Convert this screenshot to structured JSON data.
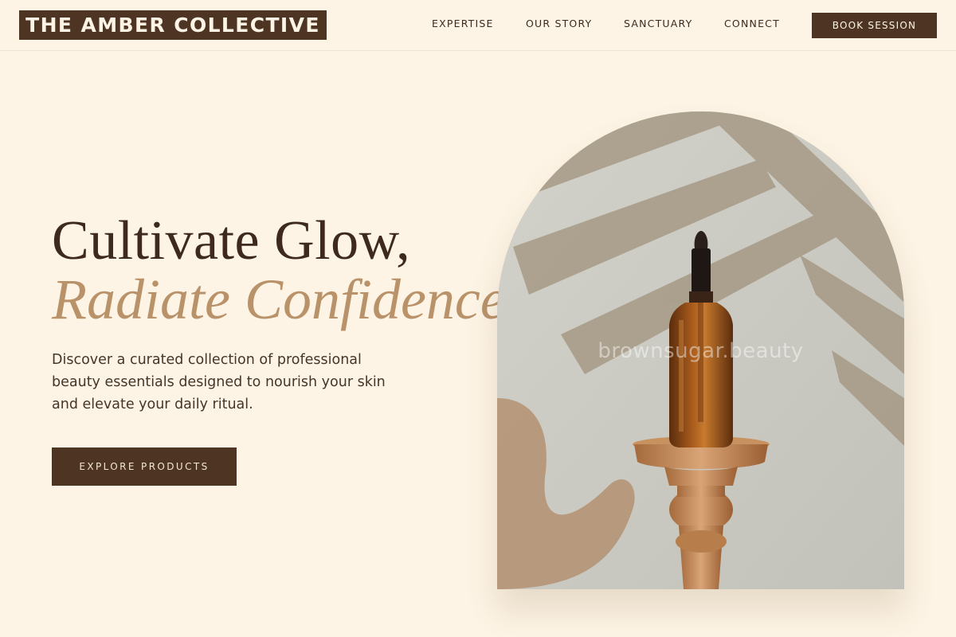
{
  "brand": {
    "name": "THE AMBER COLLECTIVE"
  },
  "nav": {
    "items": [
      {
        "label": "EXPERTISE"
      },
      {
        "label": "OUR STORY"
      },
      {
        "label": "SANCTUARY"
      },
      {
        "label": "CONNECT"
      }
    ],
    "cta_label": "BOOK SESSION"
  },
  "hero": {
    "headline_line1": "Cultivate Glow,",
    "headline_line2": "Radiate Confidence.",
    "subtext": "Discover a curated collection of professional beauty essentials designed to nourish your skin and elevate your daily ritual.",
    "cta_label": "EXPLORE PRODUCTS",
    "image": {
      "subject": "amber-dropper-bottle-on-wooden-pedestal",
      "watermark": "brownsugar.beauty"
    }
  },
  "colors": {
    "background": "#fdf4e5",
    "primary_dark": "#4e3423",
    "accent_tan": "#b9926a",
    "text": "#3d2a1d"
  }
}
